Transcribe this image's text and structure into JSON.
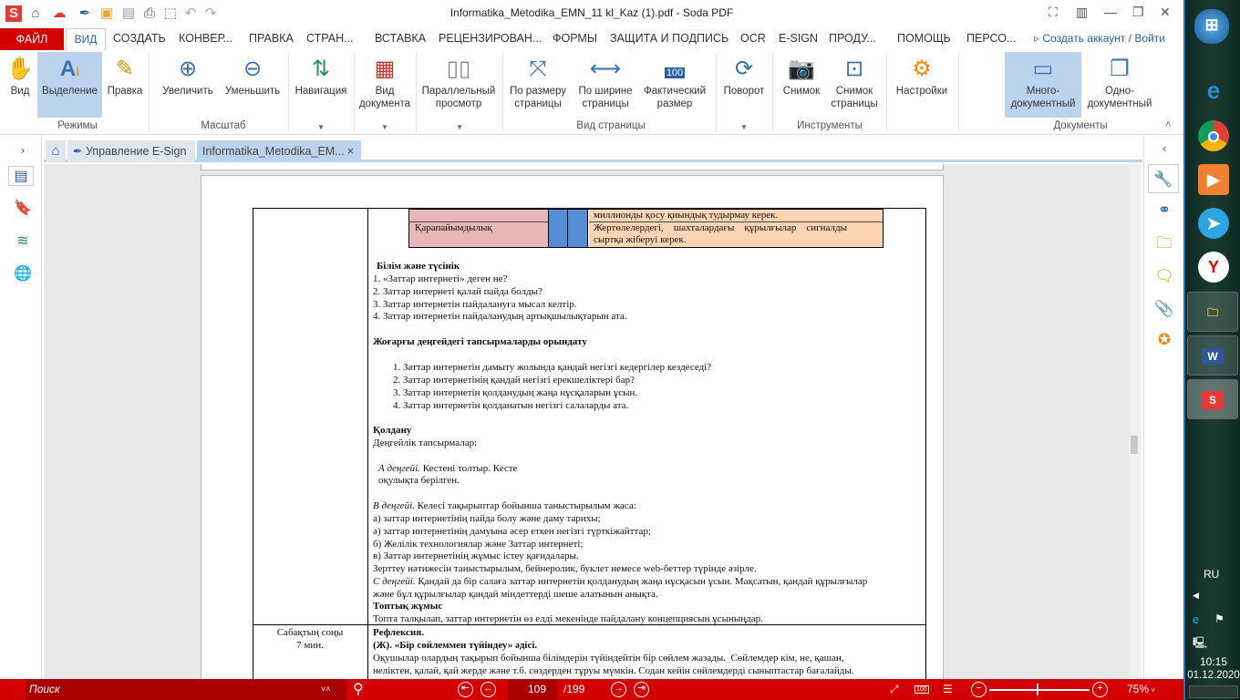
{
  "app": {
    "title": "Informatika_Metodika_EMN_11 kl_Kaz (1).pdf - Soda PDF",
    "logo": "S"
  },
  "quick_access": [
    "home-icon",
    "cloud-icon",
    "pen-icon",
    "folder-icon",
    "save-icon",
    "print-icon",
    "scan-icon",
    "undo-icon",
    "redo-icon"
  ],
  "menu": {
    "file": "ФАЙЛ",
    "items": [
      "ВИД",
      "СОЗДАТЬ",
      "КОНВЕР...",
      "ПРАВКА",
      "СТРАН...",
      "ВСТАВКА",
      "РЕЦЕНЗИРОВАН...",
      "ФОРМЫ",
      "ЗАЩИТА И ПОДПИСЬ",
      "OCR",
      "E-SIGN",
      "ПРОДУ...",
      "ПОМОЩЬ",
      "ПЕРСО..."
    ],
    "account": "Создать аккаунт / Войти"
  },
  "ribbon": {
    "buttons": {
      "hand": "Вид",
      "select": "Выделение",
      "edit": "Правка",
      "zoom_in": "Увеличить",
      "zoom_out": "Уменьшить",
      "navigation": "Навигация",
      "doc_view_1": "Вид",
      "doc_view_2": "документа",
      "parallel_1": "Параллельный",
      "parallel_2": "просмотр",
      "fit_page_1": "По размеру",
      "fit_page_2": "страницы",
      "fit_width_1": "По ширине",
      "fit_width_2": "страницы",
      "actual_1": "Фактический",
      "actual_2": "размер",
      "actual_badge": "100",
      "rotate": "Поворот",
      "snapshot": "Снимок",
      "page_snap_1": "Снимок",
      "page_snap_2": "страницы",
      "settings": "Настройки",
      "multi_1": "Много-",
      "multi_2": "документный",
      "single_1": "Одно-",
      "single_2": "документный"
    },
    "groups": {
      "modes": "Режимы",
      "scale": "Масштаб",
      "page_view": "Вид страницы",
      "tools": "Инструменты",
      "documents": "Документы"
    }
  },
  "tabs": {
    "esign": "Управление E-Sign",
    "doc": "Informatika_Metodika_EM...",
    "close": "×"
  },
  "document": {
    "inner_table": {
      "row1_right": "миллионды қосу қиындық тудырмау керек.",
      "row2_left": "Қарапайымдылық",
      "row2_right_1": "Жертөлелердегі,    шахталардағы    құрылғылар    сигналды",
      "row2_right_2": "сыртқа жіберуі керек."
    },
    "section1_title": "Білім және түсінік",
    "section1_items": [
      "1. «Заттар интернеті» деген не?",
      "2. Заттар интернеті қалай пайда болды?",
      "3. Заттар интернетін пайдалануға мысал келтір.",
      "4. Заттар интернетін пайдаланудың артықшылықтарын ата."
    ],
    "section2_title": "Жоғарғы деңгейдегі тапсырмаларды орындату",
    "section2_items": [
      "1. Заттар интернетін дамыту жолында қандай негізгі кедергілер кездеседі?",
      "2. Заттар интернетінің қандай негізгі ерекшеліктері бар?",
      "3. Заттар интернетін қолданудың жаңа нұсқаларын ұсын.",
      "4. Заттар интернетін қолданатын негізгі салаларды ата."
    ],
    "section3_title": "Қолдану",
    "section3_sub": "Деңгейлік тапсырмалар:",
    "level_a_label": "А деңгейі.",
    "level_a_text": " Кестені толтыр. Кесте",
    "level_a_text2": "оқулықта берілген.",
    "level_b_label": "В деңгейі.",
    "level_b_text": " Келесі тақырыптар бойынша таныстырылым жаса:",
    "level_b_items": [
      "а) заттар интернетінің пайда болу және даму тарихы;",
      "ә) заттар интернетінің дамуына әсер еткен негізгі түрткіжайттар;",
      "б) Желілік технологиялар және Заттар интернеті;",
      "в) Заттар интернетінің жұмыс істеу қағидалары.",
      "Зерттеу нәтижесін таныстырылым, бейнеролик, буклет немесе web-беттер түрінде әзірле."
    ],
    "level_c_label": "С деңгейі.",
    "level_c_text": " Қандай да бір салаға заттар интернетін қолданудың жаңа нұсқасын ұсын. Мақсатын, қандай құрылғылар",
    "level_c_text2": "және бұл құрылғылар қандай міндеттерді шеше алатынын анықта.",
    "group_title": "Топтық жұмыс",
    "group_text": "Топта талқылап, заттар интернетін өз елді мекенінде пайдалану концепциясын ұсыныңдар.",
    "end_label_1": "Сабақтың соңы",
    "end_label_2": "7 мин.",
    "reflection_title": "Рефлексия.",
    "reflection_method": "(Ж). «Бір сөйлеммен түйіндеу» әдісі.",
    "reflection_text_1": "Оқушылар олардың тақырып бойынша білімдерін түйіндейтін бір сөйлем жазады.  Сөйлемдер кім, не, қашан,",
    "reflection_text_2": "неліктен, қалай, қай жерде және т.б. сөздерден тұруы мүмкін. Содан кейін сөйлемдерді сыныптастар бағалайды."
  },
  "statusbar": {
    "search_placeholder": "Поиск",
    "page_current": "109",
    "page_total": "/199",
    "zoom": "75%",
    "badge": "100"
  },
  "taskbar": {
    "lang": "RU",
    "time": "10:15",
    "date": "01.12.2020",
    "word": "W",
    "soda": "S"
  },
  "colors": {
    "brand_red": "#d40000",
    "ribbon_selected": "#bcd3ee",
    "table_pink": "#e6b8b7",
    "table_blue": "#558ed5",
    "table_peach": "#fbd4b4"
  }
}
